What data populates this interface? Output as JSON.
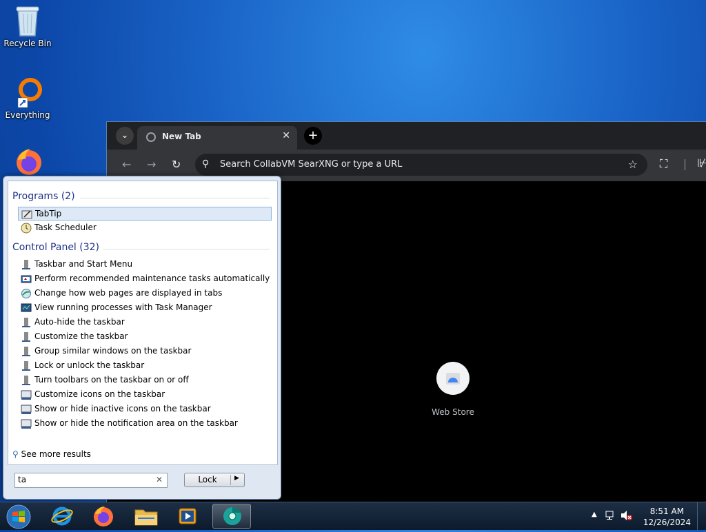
{
  "desktop": {
    "icons": [
      {
        "label": "Recycle Bin"
      },
      {
        "label": "Everything"
      }
    ]
  },
  "browser": {
    "tab_title": "New Tab",
    "omnibox_placeholder": "Search CollabVM SearXNG or type a URL",
    "shortcuts": [
      {
        "label": "Web Store"
      }
    ]
  },
  "start_menu": {
    "programs_header": "Programs (2)",
    "programs": [
      {
        "label": "TabTip",
        "selected": true
      },
      {
        "label": "Task Scheduler"
      }
    ],
    "control_panel_header": "Control Panel (32)",
    "control_panel": [
      {
        "label": "Taskbar and Start Menu"
      },
      {
        "label": "Perform recommended maintenance tasks automatically"
      },
      {
        "label": "Change how web pages are displayed in tabs"
      },
      {
        "label": "View running processes with Task Manager"
      },
      {
        "label": "Auto-hide the taskbar"
      },
      {
        "label": "Customize the taskbar"
      },
      {
        "label": "Group similar windows on the taskbar"
      },
      {
        "label": "Lock or unlock the taskbar"
      },
      {
        "label": "Turn toolbars on the taskbar on or off"
      },
      {
        "label": "Customize icons on the taskbar"
      },
      {
        "label": "Show or hide inactive icons on the taskbar"
      },
      {
        "label": "Show or hide the notification area on the taskbar"
      }
    ],
    "see_more": "See more results",
    "search_value": "ta",
    "power_button": "Lock"
  },
  "taskbar": {
    "items": [
      "start-orb",
      "internet-explorer",
      "firefox",
      "file-explorer",
      "media-player",
      "chrome"
    ],
    "clock_time": "8:51 AM",
    "clock_date": "12/26/2024"
  },
  "colors": {
    "desktop": "#1a64c7",
    "chrome_frame": "#202124",
    "chrome_toolbar": "#35363a",
    "start_header": "#1e3287"
  }
}
